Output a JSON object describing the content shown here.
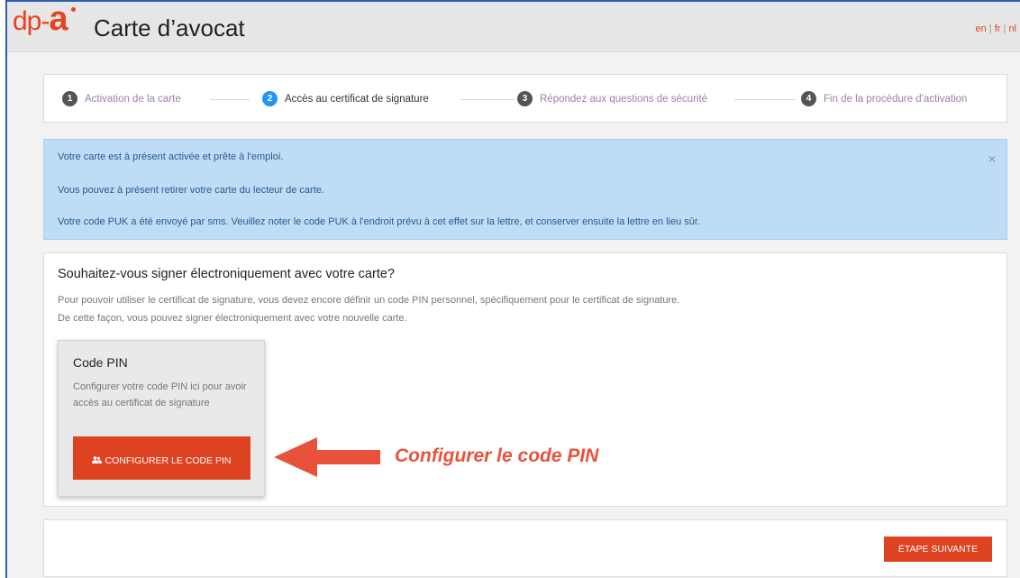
{
  "header": {
    "logo_prefix": "dp-",
    "logo_letter": "a",
    "title": "Carte d’avocat",
    "languages": [
      "en",
      "fr",
      "nl"
    ],
    "language_separator": "|"
  },
  "stepper": {
    "steps": [
      {
        "number": "1",
        "label": "Activation de la carte"
      },
      {
        "number": "2",
        "label": "Accès au certificat de signature"
      },
      {
        "number": "3",
        "label": "Répondez aux questions de sécurité"
      },
      {
        "number": "4",
        "label": "Fin de la procédure d'activation"
      }
    ],
    "active_step": 2
  },
  "alert": {
    "line1": "Votre carte est à présent activée et prête à l'emploi.",
    "line2": "Vous pouvez à présent retirer votre carte du lecteur de carte.",
    "line3": "Votre code PUK a été envoyé par sms. Veuillez noter le code PUK à l'endroit prévu à cet effet sur la lettre, et conserver ensuite la lettre en lieu sûr.",
    "close": "×"
  },
  "panel": {
    "title": "Souhaitez-vous signer électroniquement avec votre carte?",
    "desc1": "Pour pouvoir utiliser le certificat de signature, vous devez encore définir un code PIN personnel, spécifiquement pour le certificat de signature.",
    "desc2": "De cette façon, vous pouvez signer électroniquement avec votre nouvelle carte."
  },
  "card": {
    "title": "Code PIN",
    "text": "Configurer votre code PIN ici pour avoir accès au certificat de signature",
    "button_label": "CONFIGURER LE CODE PIN",
    "button_icon": "users-icon"
  },
  "annotation": {
    "text": "Configurer le code PIN",
    "color": "#e8523a"
  },
  "footer": {
    "next_label": "ÉTAPE SUIVANTE"
  },
  "colors": {
    "brand": "#e8431f",
    "button": "#dd4321",
    "active_step": "#2196f3",
    "alert_bg": "#bfdcf6",
    "frame_border": "#2f5fb3"
  }
}
